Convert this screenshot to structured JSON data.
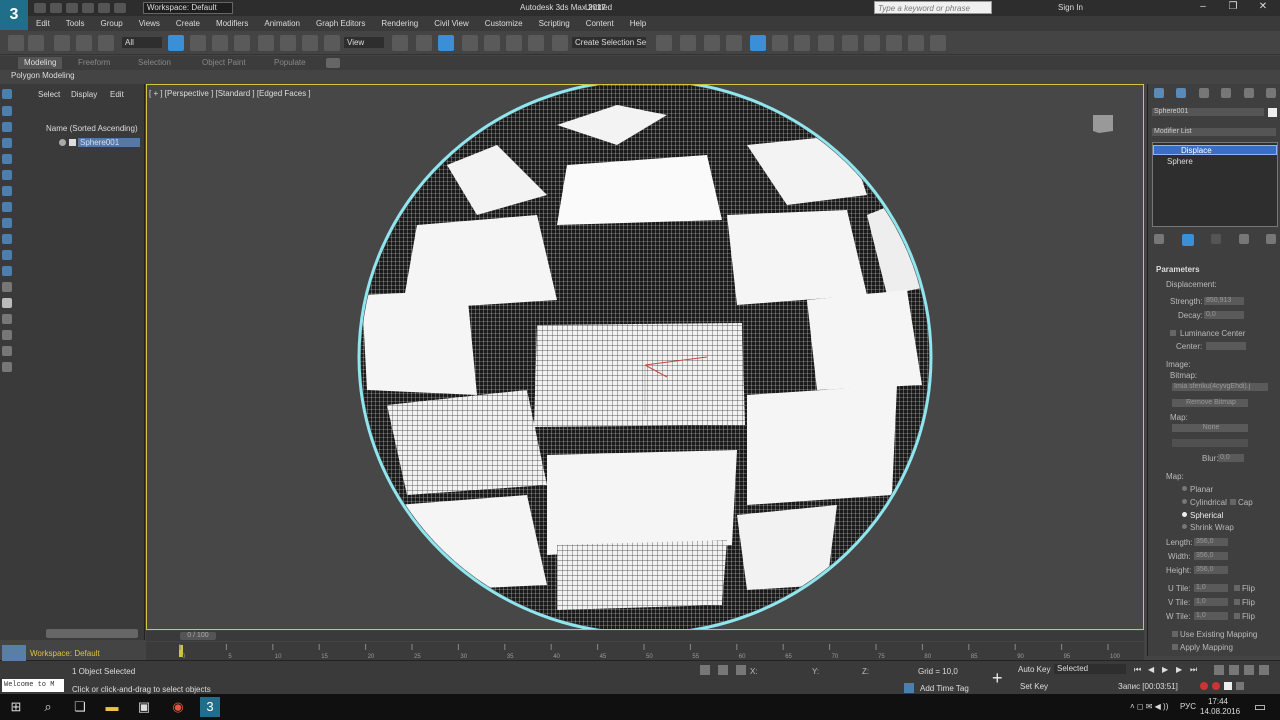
{
  "app": {
    "title": "Autodesk 3ds Max 2017",
    "document": "Untitled",
    "workspace": "Workspace: Default",
    "search_placeholder": "Type a keyword or phrase",
    "sign_in": "Sign In",
    "logo": "3"
  },
  "menu": [
    "Edit",
    "Tools",
    "Group",
    "Views",
    "Create",
    "Modifiers",
    "Animation",
    "Graph Editors",
    "Rendering",
    "Civil View",
    "Customize",
    "Scripting",
    "Content",
    "Help"
  ],
  "toolbar": {
    "selection_filter": "All",
    "view_dropdown": "View",
    "named_selection": "Create Selection Se"
  },
  "ribbon": {
    "tabs": [
      "Modeling",
      "Freeform",
      "Selection",
      "Object Paint",
      "Populate"
    ],
    "active_label": "Polygon Modeling"
  },
  "scene_explorer": {
    "tabs": [
      "Select",
      "Display",
      "Edit"
    ],
    "header": "Name (Sorted Ascending)",
    "items": [
      "Sphere001"
    ]
  },
  "viewport": {
    "label": "[ + ] [Perspective ] [Standard ] [Edged Faces ]"
  },
  "command_panel": {
    "object_name": "Sphere001",
    "modifier_list": "Modifier List",
    "stack": [
      "Displace",
      "Sphere"
    ],
    "rollout": "Parameters",
    "displacement_label": "Displacement:",
    "strength_label": "Strength:",
    "strength_value": "850,913",
    "decay_label": "Decay:",
    "decay_value": "0,0",
    "luminance_center": "Luminance Center",
    "center_label": "Center:",
    "image_label": "Image:",
    "bitmap_label": "Bitmap:",
    "bitmap_value": "Imia sferiku(4cyvgEhdi).j",
    "remove_bitmap": "Remove Bitmap",
    "map_label": "Map:",
    "map_value": "None",
    "blur_label": "Blur:",
    "blur_value": "0,0",
    "mapping_label": "Map:",
    "mapping_options": [
      "Planar",
      "Cylindrical",
      "Spherical",
      "Shrink Wrap"
    ],
    "mapping_selected": "Spherical",
    "cap_label": "Cap",
    "length_label": "Length:",
    "length_value": "356,0",
    "width_label": "Width:",
    "width_value": "356,0",
    "height_label": "Height:",
    "height_value": "356,0",
    "utile_label": "U Tile:",
    "utile_value": "1,0",
    "vtile_label": "V Tile:",
    "vtile_value": "1,0",
    "wtile_label": "W Tile:",
    "wtile_value": "1,0",
    "flip_label": "Flip",
    "use_existing": "Use Existing Mapping",
    "apply_mapping": "Apply Mapping"
  },
  "timeline": {
    "slider": "0 / 100",
    "ticks": [
      "0",
      "5",
      "10",
      "15",
      "20",
      "25",
      "30",
      "35",
      "40",
      "45",
      "50",
      "55",
      "60",
      "65",
      "70",
      "75",
      "80",
      "85",
      "90",
      "95",
      "100"
    ]
  },
  "status": {
    "workspace_footer": "Workspace: Default",
    "maxscript": "Welcome to M",
    "selection": "1 Object Selected",
    "prompt": "Click or click-and-drag to select objects",
    "x_label": "X:",
    "y_label": "Y:",
    "z_label": "Z:",
    "grid": "Grid = 10,0",
    "add_time_tag": "Add Time Tag",
    "auto_key": "Auto Key",
    "selected": "Selected",
    "set_key": "Set Key",
    "recording": "Запис [00:03:51]"
  },
  "taskbar": {
    "time": "17:44",
    "date": "14.08.2016",
    "lang": "РУС"
  }
}
